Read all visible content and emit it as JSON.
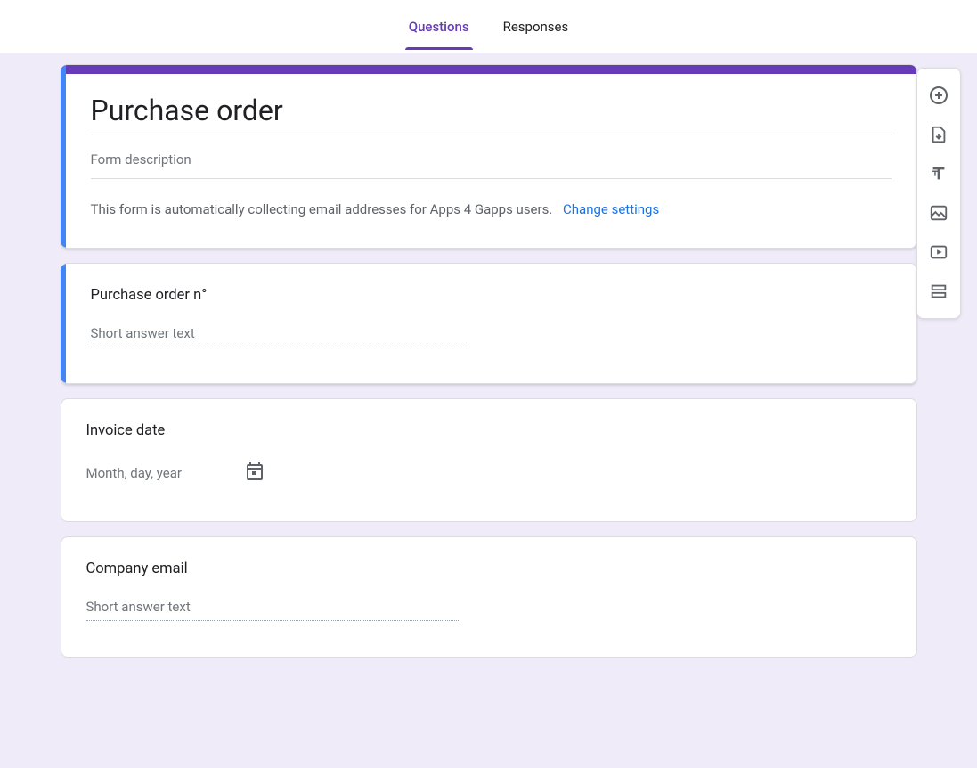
{
  "tabs": {
    "questions": "Questions",
    "responses": "Responses"
  },
  "form": {
    "title": "Purchase order",
    "description_placeholder": "Form description",
    "email_notice": "This form is automatically collecting email addresses for Apps 4 Gapps users.",
    "change_settings": "Change settings"
  },
  "questions": [
    {
      "title": "Purchase order n°",
      "placeholder": "Short answer text",
      "type": "short"
    },
    {
      "title": "Invoice date",
      "placeholder": "Month, day, year",
      "type": "date"
    },
    {
      "title": "Company email",
      "placeholder": "Short answer text",
      "type": "short"
    }
  ],
  "toolbar": {
    "add_question": "Add question",
    "import_questions": "Import questions",
    "add_title": "Add title and description",
    "add_image": "Add image",
    "add_video": "Add video",
    "add_section": "Add section"
  }
}
